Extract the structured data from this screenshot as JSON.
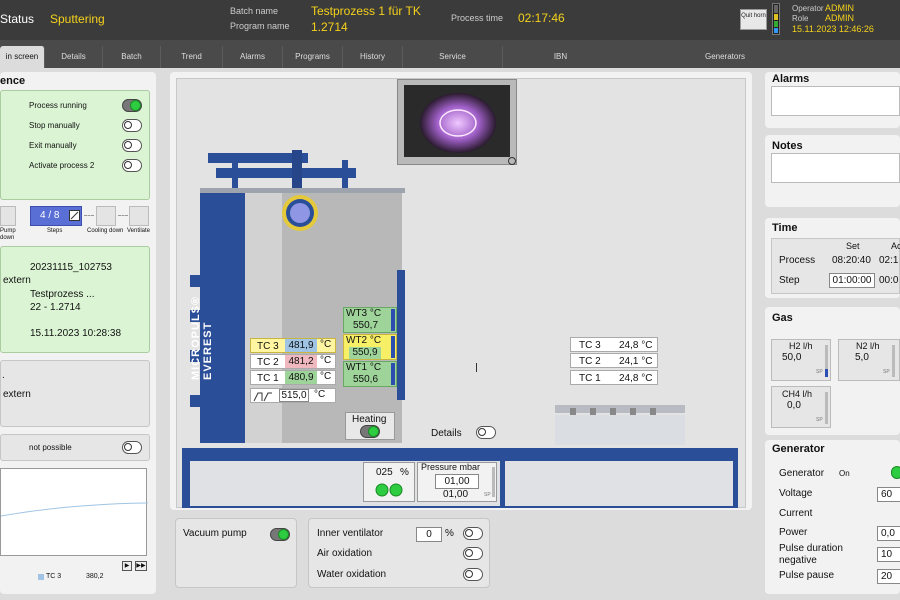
{
  "header": {
    "status_label": "Status",
    "status_value": "Sputtering",
    "batch_label": "Batch name",
    "batch_value": "Testprozess 1 für TK",
    "program_label": "Program name",
    "program_value": "1.2714",
    "process_time_label": "Process time",
    "process_time_value": "02:17:46",
    "quit_label": "Quit horn",
    "operator_label": "Operator",
    "operator_value": "ADMIN",
    "role_label": "Role",
    "role_value": "ADMIN",
    "datetime": "15.11.2023 12:46:26"
  },
  "tabs": [
    "in screen",
    "Details",
    "Batch",
    "Trend",
    "Alarms",
    "Programs",
    "History",
    "Service",
    "IBN",
    "Generators"
  ],
  "sequence": {
    "title": "ence",
    "items": [
      {
        "label": "Process running",
        "on": true
      },
      {
        "label": "Stop manually",
        "on": false
      },
      {
        "label": "Exit manually",
        "on": false
      },
      {
        "label": "Activate process 2",
        "on": false
      }
    ],
    "steps_value": "4 / 8",
    "steps_label": "Steps",
    "pump_label": "Pump down",
    "cooling_label": "Cooling down",
    "ventilate_label": "Ventilate"
  },
  "batch_info": {
    "batch_id": "20231115_102753",
    "source": "extern",
    "program_short": "Testprozess ...",
    "program_version": "22 - 1.2714",
    "start": "15.11.2023 10:28:38"
  },
  "source2": {
    "prefix": ".",
    "value": "extern"
  },
  "not_possible": "not possible",
  "trend": {
    "legend_name": "TC 3",
    "legend_value": "380,2",
    "nav_next": "▶",
    "nav_last": "▶▶"
  },
  "furnace": {
    "brand": "MICROPULS® EVEREST",
    "tc3_label": "TC 3",
    "tc3_value": "481,9",
    "tc2_label": "TC 2",
    "tc2_value": "481,2",
    "tc1_label": "TC 1",
    "tc1_value": "480,9",
    "unit": "°C",
    "setpoint": "515,0",
    "setpoint_unit": "°C",
    "wt3_label": "WT3 °C",
    "wt3_value": "550,7",
    "wt2_label": "WT2 °C",
    "wt2_value": "550,9",
    "wt1_label": "WT1 °C",
    "wt1_value": "550,6",
    "heating_label": "Heating",
    "fan_value": "025",
    "fan_unit": "%",
    "pressure_label": "Pressure mbar",
    "pressure_set": "01,00",
    "pressure_actual": "01,00",
    "pressure_small": "SP"
  },
  "cooler": {
    "tc3_label": "TC 3",
    "tc3_value": "24,8 °C",
    "tc2_label": "TC 2",
    "tc2_value": "24,1 °C",
    "tc1_label": "TC 1",
    "tc1_value": "24,8 °C",
    "details_label": "Details"
  },
  "bottom": {
    "vacuum_pump": "Vacuum pump",
    "inner_ventilator": "Inner ventilator",
    "ventilator_value": "0",
    "ventilator_unit": "%",
    "air_oxidation": "Air oxidation",
    "water_oxidation": "Water oxidation"
  },
  "right": {
    "alarms_title": "Alarms",
    "notes_title": "Notes",
    "time_title": "Time",
    "time_set_header": "Set",
    "time_act_header": "Ac",
    "process_label": "Process",
    "process_set": "08:20:40",
    "process_act": "02:1",
    "step_label": "Step",
    "step_set": "01:00:00",
    "step_act": "00:0",
    "gas_title": "Gas",
    "h2_label": "H2 l/h",
    "h2_value": "50,0",
    "n2_label": "N2 l/h",
    "n2_value": "5,0",
    "ch4_label": "CH4 l/h",
    "ch4_value": "0,0",
    "gas_sp": "SP",
    "generator_title": "Generator",
    "gen_label": "Generator",
    "gen_state": "On",
    "voltage_label": "Voltage",
    "voltage_value": "60",
    "current_label": "Current",
    "power_label": "Power",
    "power_value": "0,0",
    "pulse_neg_label": "Pulse duration negative",
    "pulse_neg_value": "10",
    "pulse_pause_label": "Pulse pause",
    "pulse_pause_value": "20"
  }
}
